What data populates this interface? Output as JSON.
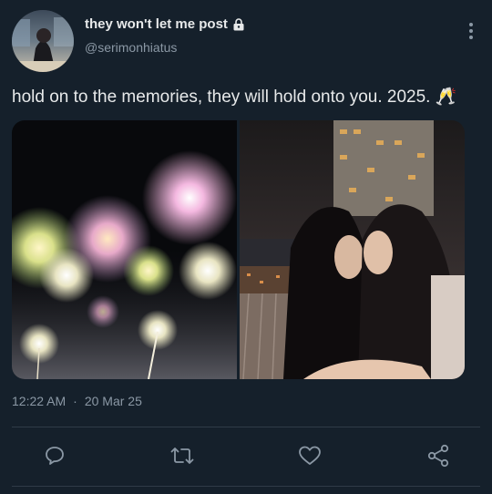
{
  "author": {
    "display_name": "they won't let me post",
    "handle": "@serimonhiatus",
    "protected_icon": "lock-icon"
  },
  "tweet": {
    "text": "hold on to the memories, they will hold onto you. 2025. 🥂"
  },
  "meta": {
    "time": "12:22 AM",
    "separator": "·",
    "date": "20 Mar 25"
  },
  "actions": {
    "icons": [
      "reply-icon",
      "retweet-icon",
      "like-icon",
      "share-icon"
    ]
  },
  "colors": {
    "background": "#15202b",
    "text_primary": "#e7e9ea",
    "text_secondary": "#8b98a5",
    "divider": "#2f3b47"
  }
}
